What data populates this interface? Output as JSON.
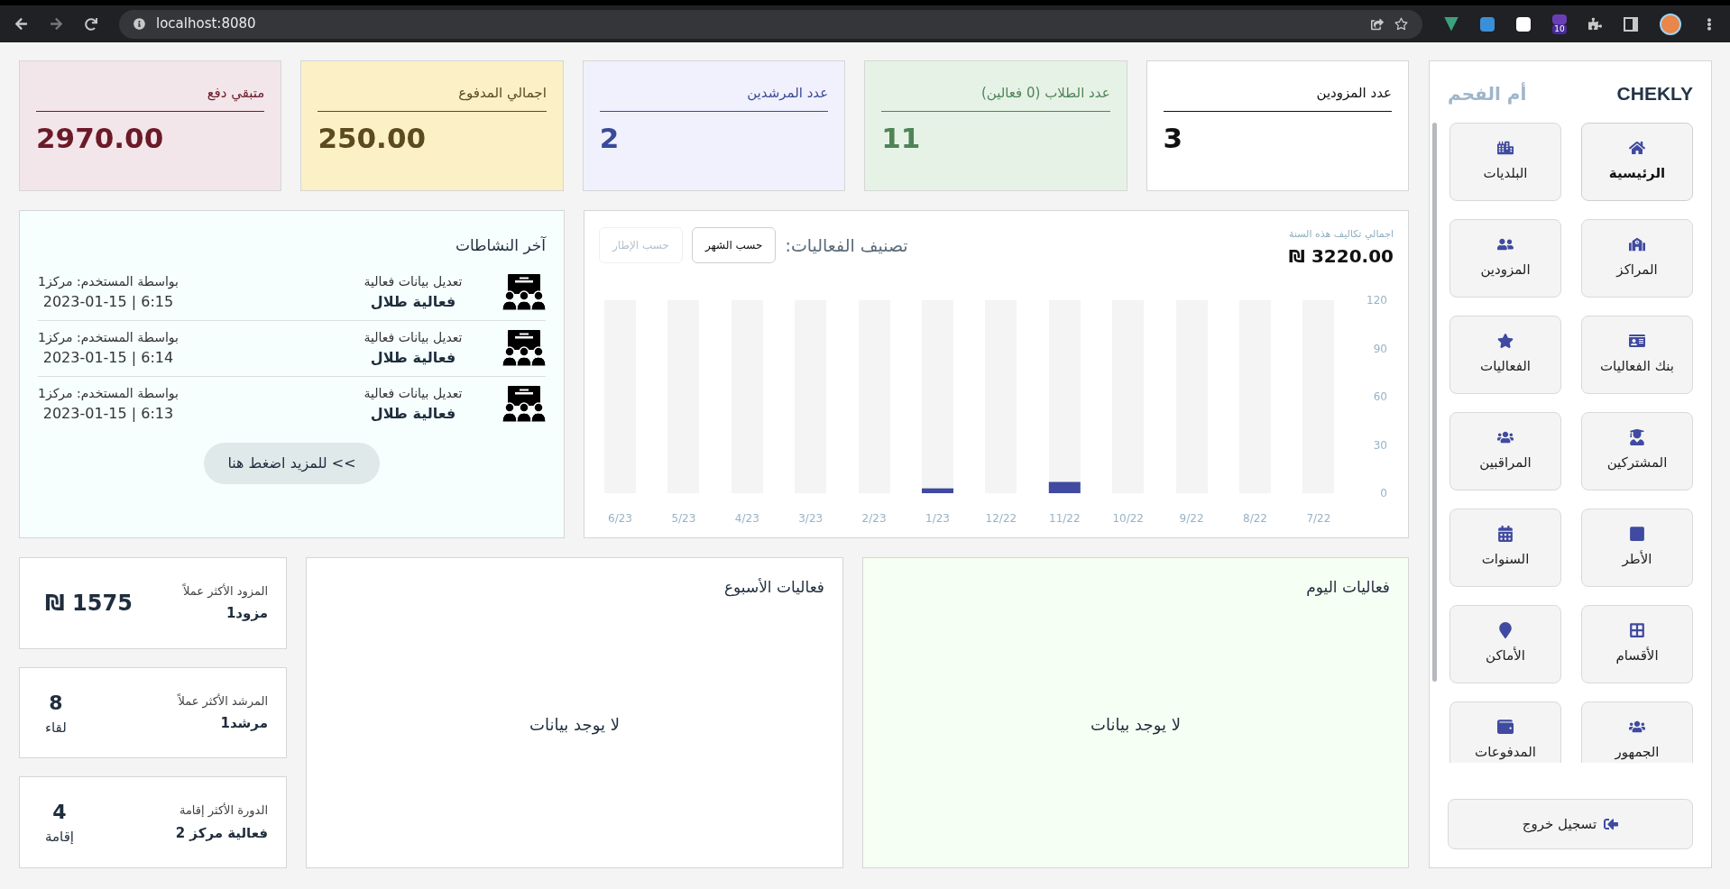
{
  "browser": {
    "address": "localhost:8080",
    "extension_badge": "10"
  },
  "sidebar": {
    "brand": "CHEKLY",
    "city": "أم الفحم",
    "items": [
      {
        "label": "الرئيسية",
        "selected": true
      },
      {
        "label": "البلديات",
        "selected": false
      },
      {
        "label": "المراكز",
        "selected": false
      },
      {
        "label": "المزودين",
        "selected": false
      },
      {
        "label": "بنك الفعاليات",
        "selected": false
      },
      {
        "label": "الفعاليات",
        "selected": false
      },
      {
        "label": "المشتركين",
        "selected": false
      },
      {
        "label": "المراقبين",
        "selected": false
      },
      {
        "label": "الأطر",
        "selected": false
      },
      {
        "label": "السنوات",
        "selected": false
      },
      {
        "label": "الأقسام",
        "selected": false
      },
      {
        "label": "الأماكن",
        "selected": false
      },
      {
        "label": "الجمهور",
        "selected": false
      },
      {
        "label": "المدفوعات",
        "selected": false
      }
    ],
    "logout": "تسجيل خروج"
  },
  "stats": [
    {
      "label": "عدد المزودين",
      "value": "3",
      "color": "#111111"
    },
    {
      "label": "عدد الطلاب (0 فعالين)",
      "value": "11",
      "color": "#4e8456"
    },
    {
      "label": "عدد المرشدين",
      "value": "2",
      "color": "#3a4a9a"
    },
    {
      "label": "اجمالي المدفوع",
      "value": "250.00",
      "color": "#5c4a20"
    },
    {
      "label": "متبقي دفع",
      "value": "2970.00",
      "color": "#6b1a28"
    }
  ],
  "chart_panel": {
    "total_label": "اجمالي تكاليف هذه السنة",
    "total": "3220.00 ₪",
    "filters": [
      {
        "label": "حسب الشهر",
        "selected": true
      },
      {
        "label": "حسب الإطار",
        "selected": false
      }
    ],
    "chart_data": {
      "type": "bar",
      "title": "تصنيف الفعاليات:",
      "categories": [
        "6/23",
        "5/23",
        "4/23",
        "3/23",
        "2/23",
        "1/23",
        "12/22",
        "11/22",
        "10/22",
        "9/22",
        "8/22",
        "7/22"
      ],
      "values": [
        0,
        0,
        0,
        0,
        0,
        3,
        0,
        7,
        0,
        0,
        0,
        0
      ],
      "ylim": [
        0,
        120
      ],
      "yticks": [
        0,
        30,
        60,
        90,
        120
      ]
    }
  },
  "activity": {
    "title": "آخر النشاطات",
    "items": [
      {
        "action": "تعديل بيانات فعالية",
        "name": "فعالية طلال",
        "user": "بواسطة المستخدم: مركز1",
        "time": "2023-01-15 | 6:15"
      },
      {
        "action": "تعديل بيانات فعالية",
        "name": "فعالية طلال",
        "user": "بواسطة المستخدم: مركز1",
        "time": "2023-01-15 | 6:14"
      },
      {
        "action": "تعديل بيانات فعالية",
        "name": "فعالية طلال",
        "user": "بواسطة المستخدم: مركز1",
        "time": "2023-01-15 | 6:13"
      }
    ],
    "more": "للمزيد اضغط هنا <<"
  },
  "today": {
    "title": "فعاليات اليوم",
    "empty": "لا يوجد بيانات"
  },
  "week": {
    "title": "فعاليات الأسبوع",
    "empty": "لا يوجد بيانات"
  },
  "top": [
    {
      "label": "المزود الأكثر عملاً",
      "name": "مزود1",
      "value": "1575 ₪"
    },
    {
      "label": "المرشد الأكثر عملاً",
      "name": "مرشد1",
      "value": "8",
      "unit": "لقاء"
    },
    {
      "label": "الدورة الأكثر إقامة",
      "name": "فعالية مركز 2",
      "value": "4",
      "unit": "إقامة"
    }
  ]
}
